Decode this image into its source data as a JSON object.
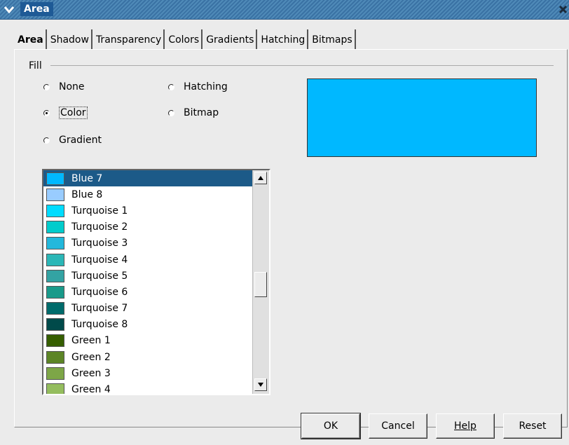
{
  "window": {
    "title": "Area",
    "menu_icon": "chevron-down-icon",
    "close_icon": "close-icon"
  },
  "tabs": [
    {
      "label": "Area",
      "active": true
    },
    {
      "label": "Shadow",
      "active": false
    },
    {
      "label": "Transparency",
      "active": false
    },
    {
      "label": "Colors",
      "active": false
    },
    {
      "label": "Gradients",
      "active": false
    },
    {
      "label": "Hatching",
      "active": false
    },
    {
      "label": "Bitmaps",
      "active": false
    }
  ],
  "fill": {
    "label": "Fill",
    "options": {
      "none": {
        "label": "None",
        "checked": false
      },
      "color": {
        "label": "Color",
        "checked": true
      },
      "gradient": {
        "label": "Gradient",
        "checked": false
      },
      "hatching": {
        "label": "Hatching",
        "checked": false
      },
      "bitmap": {
        "label": "Bitmap",
        "checked": false
      }
    }
  },
  "preview": {
    "color": "#00b8ff"
  },
  "colors": [
    {
      "name": "Blue 7",
      "hex": "#00b8ff",
      "selected": true
    },
    {
      "name": "Blue 8",
      "hex": "#99ccff",
      "selected": false
    },
    {
      "name": "Turquoise 1",
      "hex": "#00dcff",
      "selected": false
    },
    {
      "name": "Turquoise 2",
      "hex": "#00cccc",
      "selected": false
    },
    {
      "name": "Turquoise 3",
      "hex": "#23b8dc",
      "selected": false
    },
    {
      "name": "Turquoise 4",
      "hex": "#2bb7b7",
      "selected": false
    },
    {
      "name": "Turquoise 5",
      "hex": "#33a3a3",
      "selected": false
    },
    {
      "name": "Turquoise 6",
      "hex": "#199a8a",
      "selected": false
    },
    {
      "name": "Turquoise 7",
      "hex": "#006b6b",
      "selected": false
    },
    {
      "name": "Turquoise 8",
      "hex": "#004a4a",
      "selected": false
    },
    {
      "name": "Green 1",
      "hex": "#355e00",
      "selected": false
    },
    {
      "name": "Green 2",
      "hex": "#5c8526",
      "selected": false
    },
    {
      "name": "Green 3",
      "hex": "#7da647",
      "selected": false
    },
    {
      "name": "Green 4",
      "hex": "#94bd5e",
      "selected": false
    }
  ],
  "scroll": {
    "position": 0.52
  },
  "buttons": {
    "ok": "OK",
    "cancel": "Cancel",
    "help": "Help",
    "reset": "Reset"
  }
}
